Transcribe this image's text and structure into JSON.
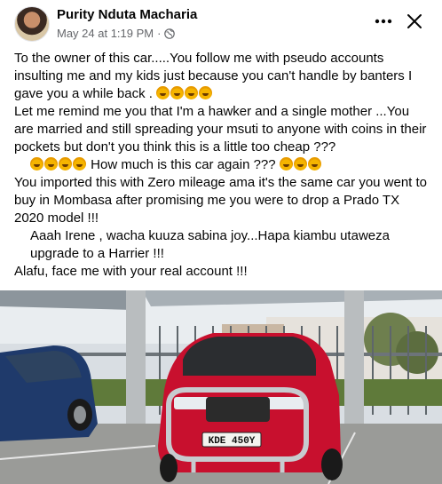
{
  "post": {
    "author": "Purity Nduta Macharia",
    "date": "May 24 at 1:19 PM",
    "separator": "·",
    "icons": {
      "privacy": "globe-icon",
      "more": "more-horizontal-icon",
      "close": "close-icon"
    },
    "paragraphs": [
      {
        "before": "To the owner of this car.....You follow me with pseudo accounts insulting me and my kids just because you can't handle by banters I gave you a while back .",
        "emoji_before": 0,
        "emoji_after": 4,
        "after": ""
      },
      {
        "before": "Let me remind me you that I'm a hawker and a single mother ...You are married and still spreading your msuti to anyone with coins in their pockets but don't you think this is a little too cheap ???",
        "emoji_before": 0,
        "emoji_after": 0,
        "after": ""
      },
      {
        "before": "",
        "emoji_before": 4,
        "emoji_after": 3,
        "after": "How much is this car again ???"
      },
      {
        "before": "You imported this with Zero mileage  ama it's the same car you went to buy in Mombasa after promising  me you were to drop a Prado TX 2020 model !!!",
        "emoji_before": 0,
        "emoji_after": 0,
        "after": ""
      },
      {
        "before": "Aaah Irene , wacha kuuza sabina joy...Hapa kiambu utaweza upgrade to a Harrier !!!",
        "emoji_before": 0,
        "emoji_after": 0,
        "after": ""
      },
      {
        "before": "Alafu, face me with your real account !!!",
        "emoji_before": 0,
        "emoji_after": 0,
        "after": ""
      }
    ],
    "emoji_name": "rolling-on-floor-laughing-emoji",
    "photo": {
      "plate_text": "KDE 450Y",
      "car_color": "#c8102e",
      "second_car_color": "#1f3a6b"
    }
  }
}
